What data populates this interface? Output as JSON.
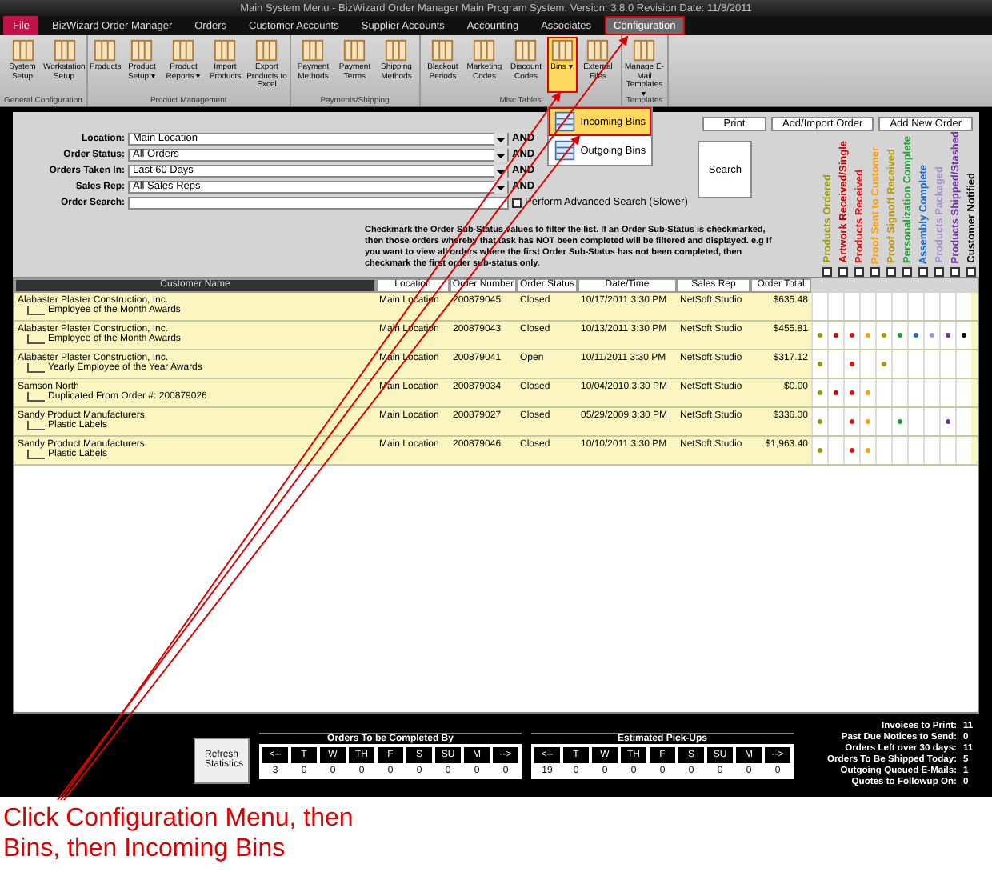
{
  "window": {
    "title": "Main System Menu - BizWizard Order Manager Main Program System. Version: 3.8.0  Revision Date: 11/8/2011"
  },
  "tabs": [
    {
      "label": "File",
      "kind": "file",
      "selected": false
    },
    {
      "label": "BizWizard Order Manager",
      "kind": "tab",
      "selected": false
    },
    {
      "label": "Orders",
      "kind": "tab",
      "selected": false
    },
    {
      "label": "Customer Accounts",
      "kind": "tab",
      "selected": false
    },
    {
      "label": "Supplier Accounts",
      "kind": "tab",
      "selected": false
    },
    {
      "label": "Accounting",
      "kind": "tab",
      "selected": false
    },
    {
      "label": "Associates",
      "kind": "tab",
      "selected": false
    },
    {
      "label": "Configuration",
      "kind": "tab",
      "selected": true
    }
  ],
  "ribbon": [
    {
      "label": "General Configuration",
      "buttons": [
        {
          "label": "System Setup",
          "selected": false
        },
        {
          "label": "Workstation Setup",
          "selected": false
        }
      ]
    },
    {
      "label": "Product Management",
      "buttons": [
        {
          "label": "Products",
          "selected": false
        },
        {
          "label": "Product Setup ▾",
          "selected": false
        },
        {
          "label": "Product Reports ▾",
          "selected": false
        },
        {
          "label": "Import Products",
          "selected": false
        },
        {
          "label": "Export Products to Excel",
          "selected": false
        }
      ]
    },
    {
      "label": "Payments/Shipping",
      "buttons": [
        {
          "label": "Payment Methods",
          "selected": false
        },
        {
          "label": "Payment Terms",
          "selected": false
        },
        {
          "label": "Shipping Methods",
          "selected": false
        }
      ]
    },
    {
      "label": "Misc Tables",
      "buttons": [
        {
          "label": "Blackout Periods",
          "selected": false
        },
        {
          "label": "Marketing Codes",
          "selected": false
        },
        {
          "label": "Discount Codes",
          "selected": false
        },
        {
          "label": "Bins ▾",
          "selected": true,
          "menu": [
            {
              "label": "Incoming Bins",
              "selected": true
            },
            {
              "label": "Outgoing Bins",
              "selected": false
            }
          ]
        },
        {
          "label": "External Files",
          "selected": false
        }
      ]
    },
    {
      "label": "Templates",
      "buttons": [
        {
          "label": "Manage E-Mail Templates ▾",
          "selected": false
        }
      ]
    }
  ],
  "filters": [
    {
      "label": "Location:",
      "value": "Main Location",
      "joiner": "AND"
    },
    {
      "label": "Order Status:",
      "value": "All Orders",
      "joiner": "AND"
    },
    {
      "label": "Orders Taken In:",
      "value": "Last 60 Days",
      "joiner": "AND"
    },
    {
      "label": "Sales Rep:",
      "value": "All Sales Reps",
      "joiner": "AND"
    }
  ],
  "order_search": {
    "label": "Order Search:"
  },
  "search_button": "Search",
  "advanced_search": {
    "label": "Perform Advanced Search (Slower)",
    "checked": false
  },
  "action_buttons": [
    "Print",
    "Add/Import Order",
    "Add New Order"
  ],
  "note": "Checkmark the Order Sub-Status values to filter the list.  If an Order Sub-Status is checkmarked, then those orders whereby that task has NOT been completed will be filtered and displayed.  e.g If you want to view all orders where the first Order Sub-Status has not been completed, then checkmark the first order sub-status only.",
  "columns": [
    "Customer Name",
    "Location",
    "Order Number",
    "Order Status",
    "Date/Time",
    "Sales Rep",
    "Order Total"
  ],
  "substatus_columns": [
    {
      "label": "Products Ordered",
      "color": "#9a9a00",
      "checked": false
    },
    {
      "label": "Artwork Received/Single",
      "color": "#cc0000",
      "checked": false
    },
    {
      "label": "Products Received",
      "color": "#ee1010",
      "checked": false
    },
    {
      "label": "Proof Sent to Customer",
      "color": "#ffa000",
      "checked": false
    },
    {
      "label": "Proof Signoff Received",
      "color": "#b89a00",
      "checked": false
    },
    {
      "label": "Personalization Complete",
      "color": "#20a030",
      "checked": false
    },
    {
      "label": "Assembly Complete",
      "color": "#1a6ad0",
      "checked": false
    },
    {
      "label": "Products Packaged",
      "color": "#a890d0",
      "checked": false
    },
    {
      "label": "Products Shipped/Stashed",
      "color": "#7030a0",
      "checked": false
    },
    {
      "label": "Customer Notified",
      "color": "#000000",
      "checked": false
    }
  ],
  "rows": [
    {
      "customer": "Alabaster Plaster Construction, Inc.",
      "detail": "Employee of the Month Awards",
      "location": "Main Location",
      "order_number": "200879045",
      "status": "Closed",
      "date": "10/17/2011 3:30 PM",
      "rep": "NetSoft Studio",
      "total": "$635.48",
      "done": [
        false,
        false,
        false,
        false,
        false,
        false,
        false,
        false,
        false,
        false
      ]
    },
    {
      "customer": "Alabaster Plaster Construction, Inc.",
      "detail": "Employee of the Month Awards",
      "location": "Main Location",
      "order_number": "200879043",
      "status": "Closed",
      "date": "10/13/2011 3:30 PM",
      "rep": "NetSoft Studio",
      "total": "$455.81",
      "done": [
        true,
        true,
        true,
        true,
        true,
        true,
        true,
        true,
        true,
        true
      ]
    },
    {
      "customer": "Alabaster Plaster Construction, Inc.",
      "detail": "Yearly Employee of the Year Awards",
      "location": "Main Location",
      "order_number": "200879041",
      "status": "Open",
      "date": "10/11/2011 3:30 PM",
      "rep": "NetSoft Studio",
      "total": "$317.12",
      "done": [
        true,
        false,
        true,
        false,
        true,
        false,
        false,
        false,
        false,
        false
      ]
    },
    {
      "customer": "Samson North",
      "detail": "Duplicated From Order #: 200879026",
      "location": "Main Location",
      "order_number": "200879034",
      "status": "Closed",
      "date": "10/04/2010 3:30 PM",
      "rep": "NetSoft Studio",
      "total": "$0.00",
      "done": [
        true,
        true,
        true,
        true,
        false,
        false,
        false,
        false,
        false,
        false
      ]
    },
    {
      "customer": "Sandy Product Manufacturers",
      "detail": "Plastic Labels",
      "location": "Main Location",
      "order_number": "200879027",
      "status": "Closed",
      "date": "05/29/2009 3:30 PM",
      "rep": "NetSoft Studio",
      "total": "$336.00",
      "done": [
        true,
        false,
        true,
        true,
        false,
        true,
        false,
        false,
        true,
        false
      ]
    },
    {
      "customer": "Sandy Product Manufacturers",
      "detail": "Plastic Labels",
      "location": "Main Location",
      "order_number": "200879046",
      "status": "Closed",
      "date": "10/10/2011 3:30 PM",
      "rep": "NetSoft Studio",
      "total": "$1,963.40",
      "done": [
        true,
        false,
        true,
        true,
        false,
        false,
        false,
        false,
        false,
        false
      ]
    }
  ],
  "refresh_button": "Refresh Statistics",
  "day_panels": [
    {
      "title": "Orders To be Completed By",
      "days": [
        {
          "label": "<--",
          "count": "3"
        },
        {
          "label": "T",
          "count": "0"
        },
        {
          "label": "W",
          "count": "0"
        },
        {
          "label": "TH",
          "count": "0"
        },
        {
          "label": "F",
          "count": "0"
        },
        {
          "label": "S",
          "count": "0"
        },
        {
          "label": "SU",
          "count": "0"
        },
        {
          "label": "M",
          "count": "0"
        },
        {
          "label": "-->",
          "count": "0"
        }
      ]
    },
    {
      "title": "Estimated Pick-Ups",
      "days": [
        {
          "label": "<--",
          "count": "19"
        },
        {
          "label": "T",
          "count": "0"
        },
        {
          "label": "W",
          "count": "0"
        },
        {
          "label": "TH",
          "count": "0"
        },
        {
          "label": "F",
          "count": "0"
        },
        {
          "label": "S",
          "count": "0"
        },
        {
          "label": "SU",
          "count": "0"
        },
        {
          "label": "M",
          "count": "0"
        },
        {
          "label": "-->",
          "count": "0"
        }
      ]
    }
  ],
  "statistics": [
    {
      "label": "Invoices to Print:",
      "value": "11"
    },
    {
      "label": "Past Due Notices to Send:",
      "value": "0"
    },
    {
      "label": "Orders Left over 30 days:",
      "value": "11"
    },
    {
      "label": "Orders To Be Shipped Today:",
      "value": "5"
    },
    {
      "label": "Outgoing Queued E-Mails:",
      "value": "1"
    },
    {
      "label": "Quotes to Followup On:",
      "value": "0"
    }
  ],
  "caption": "Click Configuration Menu, then Bins, then Incoming Bins"
}
